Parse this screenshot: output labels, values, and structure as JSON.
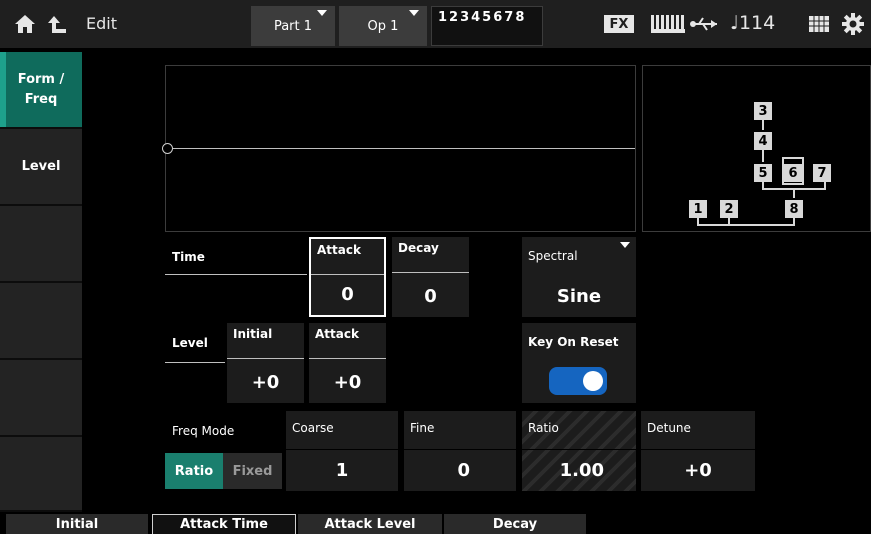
{
  "header": {
    "edit_label": "Edit",
    "part_label": "Part 1",
    "op_label": "Op 1",
    "op_numbers": "12345678",
    "fx_label": "FX",
    "tempo": "♩114"
  },
  "sidebar": {
    "items": [
      {
        "label": "Form /\nFreq",
        "active": true
      },
      {
        "label": "Level",
        "active": false
      },
      {
        "label": "",
        "active": false
      },
      {
        "label": "",
        "active": false
      },
      {
        "label": "",
        "active": false
      },
      {
        "label": "",
        "active": false
      }
    ]
  },
  "algorithm": {
    "nodes": [
      "3",
      "4",
      "5",
      "6",
      "7",
      "1",
      "2",
      "8"
    ]
  },
  "eg": {
    "time_label": "Time",
    "level_label": "Level",
    "attack_time": {
      "label": "Attack",
      "value": "0"
    },
    "decay_time": {
      "label": "Decay",
      "value": "0"
    },
    "initial_level": {
      "label": "Initial",
      "value": "+0"
    },
    "attack_level": {
      "label": "Attack",
      "value": "+0"
    }
  },
  "spectral": {
    "label": "Spectral",
    "value": "Sine"
  },
  "key_on_reset": {
    "label": "Key On Reset",
    "on": true
  },
  "freq": {
    "mode_label": "Freq Mode",
    "mode_ratio": "Ratio",
    "mode_fixed": "Fixed",
    "coarse": {
      "label": "Coarse",
      "value": "1"
    },
    "fine": {
      "label": "Fine",
      "value": "0"
    },
    "ratio": {
      "label": "Ratio",
      "value": "1.00"
    },
    "detune": {
      "label": "Detune",
      "value": "+0"
    }
  },
  "bottom_tabs": [
    {
      "label": "Initial",
      "active": false
    },
    {
      "label": "Attack Time",
      "active": true
    },
    {
      "label": "Attack Level",
      "active": false
    },
    {
      "label": "Decay",
      "active": false
    }
  ],
  "colors": {
    "accent": "#0f6b5c",
    "toggle": "#1565c0",
    "ratio_active": "#1a7f6e"
  }
}
